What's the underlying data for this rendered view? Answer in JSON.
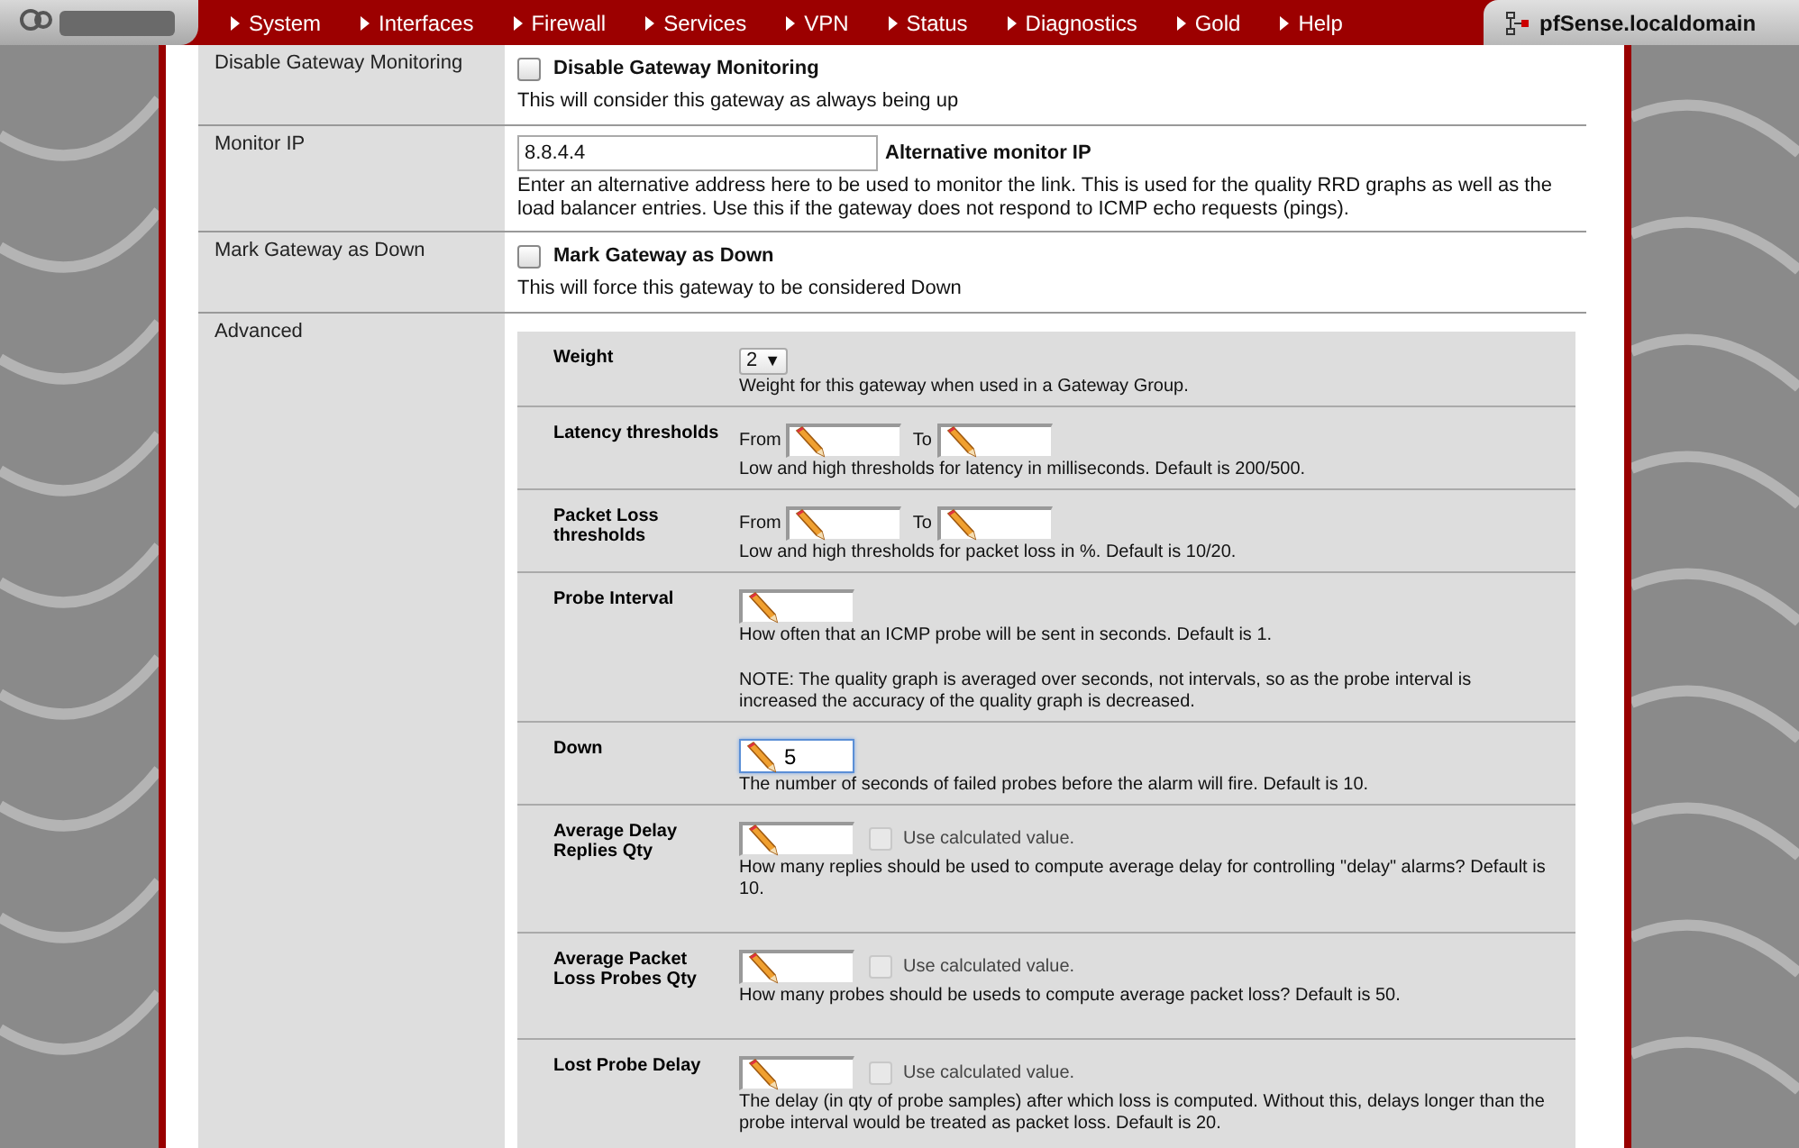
{
  "nav": {
    "items": [
      "System",
      "Interfaces",
      "Firewall",
      "Services",
      "VPN",
      "Status",
      "Diagnostics",
      "Gold",
      "Help"
    ],
    "hostname": "pfSense.localdomain"
  },
  "rows": [
    {
      "kind": "checkbox",
      "label": "Disable Gateway Monitoring",
      "checkbox_label": "Disable Gateway Monitoring",
      "checked": false,
      "description": "This will consider this gateway as always being up"
    },
    {
      "kind": "input",
      "label": "Monitor IP",
      "value": "8.8.4.4",
      "inline_label": "Alternative monitor IP",
      "description": "Enter an alternative address here to be used to monitor the link. This is used for the quality RRD graphs as well as the load balancer entries. Use this if the gateway does not respond to ICMP echo requests (pings)."
    },
    {
      "kind": "checkbox",
      "label": "Mark Gateway as Down",
      "checkbox_label": "Mark Gateway as Down",
      "checked": false,
      "description": "This will force this gateway to be considered Down"
    },
    {
      "kind": "advanced",
      "label": "Advanced",
      "fields": [
        {
          "kind": "select",
          "label": "Weight",
          "value": "2",
          "caret": "▼",
          "description": "Weight for this gateway when used in a Gateway Group."
        },
        {
          "kind": "range",
          "label": "Latency thresholds",
          "from_label": "From",
          "to_label": "To",
          "description": "Low and high thresholds for latency in milliseconds. Default is 200/500."
        },
        {
          "kind": "range",
          "label": "Packet Loss thresholds",
          "from_label": "From",
          "to_label": "To",
          "description": "Low and high thresholds for packet loss in %. Default is 10/20."
        },
        {
          "kind": "input",
          "label": "Probe Interval",
          "focused": false,
          "description": "How often that an ICMP probe will be sent in seconds. Default is 1.",
          "note": "NOTE: The quality graph is averaged over seconds, not intervals, so as the probe interval is increased the accuracy of the quality graph is decreased."
        },
        {
          "kind": "input",
          "label": "Down",
          "value": "5",
          "focused": true,
          "description": "The number of seconds of failed probes before the alarm will fire. Default is 10."
        },
        {
          "kind": "calc",
          "label": "Average Delay Replies Qty",
          "checkbox_label": "Use calculated value.",
          "checked": false,
          "disabled": true,
          "description": "How many replies should be used to compute average delay for controlling \"delay\" alarms? Default is 10."
        },
        {
          "kind": "calc",
          "label": "Average Packet Loss Probes Qty",
          "checkbox_label": "Use calculated value.",
          "checked": false,
          "disabled": true,
          "description": "How many probes should be useds to compute average packet loss? Default is 50."
        },
        {
          "kind": "calc",
          "label": "Lost Probe Delay",
          "checkbox_label": "Use calculated value.",
          "checked": false,
          "disabled": true,
          "description": "The delay (in qty of probe samples) after which loss is computed. Without this, delays longer than the probe interval would be treated as packet loss. Default is 20."
        }
      ]
    }
  ]
}
